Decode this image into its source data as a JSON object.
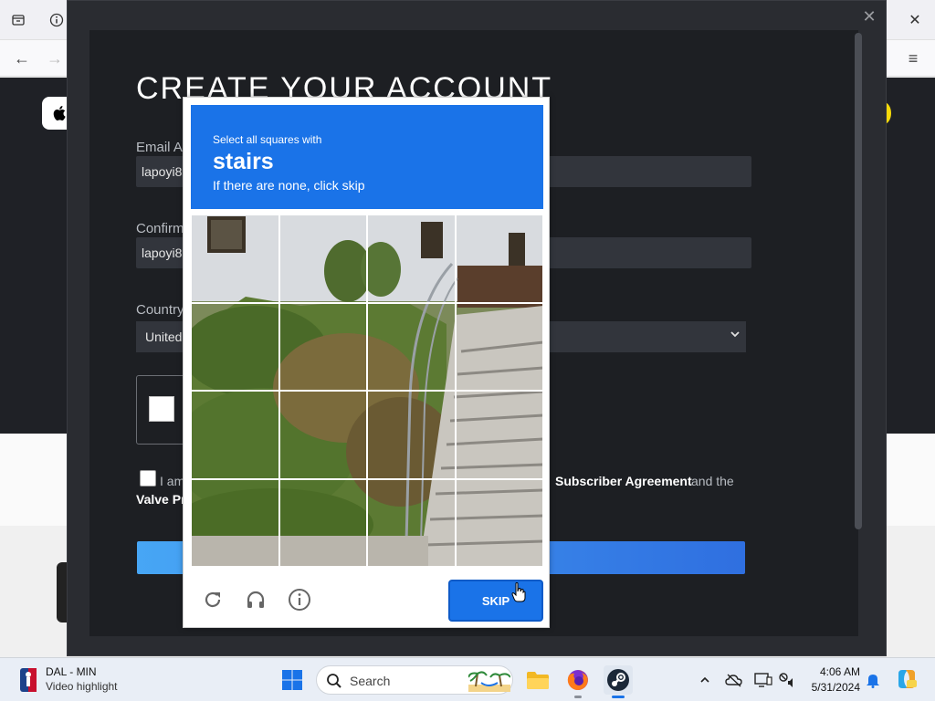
{
  "modal": {
    "title": "CREATE YOUR ACCOUNT",
    "close_label": "✕"
  },
  "form": {
    "email_label": "Email Ac",
    "email_value": "lapoyi8",
    "confirm_label": "Confirm",
    "confirm_value": "lapoyi8",
    "country_label": "Country",
    "country_value": "United"
  },
  "agreement": {
    "text_start": "I am",
    "link_subscriber": "Subscriber Agreement",
    "text_and": "and the",
    "line2": "Valve Pr"
  },
  "captcha": {
    "prompt": "Select all squares with",
    "target_word": "stairs",
    "subtext": "If there are none, click skip",
    "skip_label": "SKIP",
    "tiles": [
      {
        "id": "r1c1"
      },
      {
        "id": "r1c2"
      },
      {
        "id": "r1c3"
      },
      {
        "id": "r1c4"
      },
      {
        "id": "r2c1"
      },
      {
        "id": "r2c2"
      },
      {
        "id": "r2c3"
      },
      {
        "id": "r2c4"
      },
      {
        "id": "r3c1"
      },
      {
        "id": "r3c2"
      },
      {
        "id": "r3c3"
      },
      {
        "id": "r3c4"
      },
      {
        "id": "r4c1"
      },
      {
        "id": "r4c2"
      },
      {
        "id": "r4c3"
      },
      {
        "id": "r4c4"
      }
    ],
    "header_color": "#1a73e8"
  },
  "taskbar": {
    "weather_title": "DAL - MIN",
    "weather_sub": "Video highlight",
    "search_label": "Search",
    "time": "4:06 AM",
    "date": "5/31/2024"
  },
  "colors": {
    "accent": "#1a73e8",
    "modal_bg": "#1d1f23",
    "steam_button_start": "#47a6f5",
    "steam_button_end": "#2f6fe0"
  }
}
